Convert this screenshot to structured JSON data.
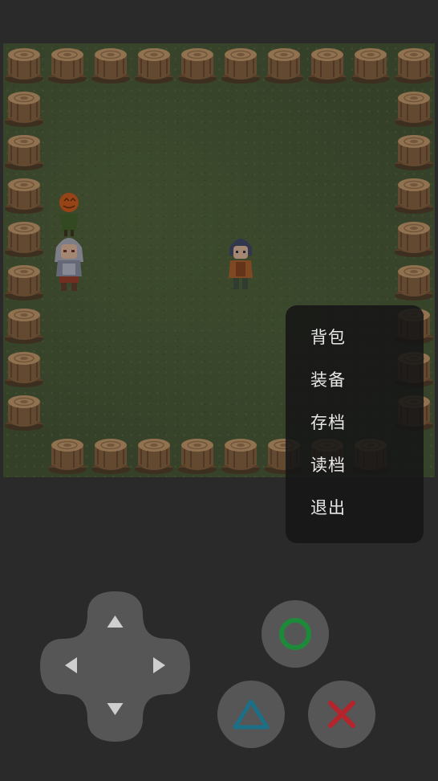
{
  "menu": {
    "items": [
      {
        "label": "背包"
      },
      {
        "label": "装备"
      },
      {
        "label": "存档"
      },
      {
        "label": "读档"
      },
      {
        "label": "退出"
      }
    ]
  },
  "controls": {
    "dpad_icons": [
      "arrow-up-icon",
      "arrow-down-icon",
      "arrow-left-icon",
      "arrow-right-icon"
    ],
    "action_buttons": [
      {
        "name": "circle-button",
        "icon": "circle-icon",
        "color": "#1d8a3a"
      },
      {
        "name": "triangle-button",
        "icon": "triangle-icon",
        "color": "#1b6f86"
      },
      {
        "name": "cross-button",
        "icon": "cross-icon",
        "color": "#b5232b"
      }
    ]
  },
  "colors": {
    "background": "#2a2a2a",
    "grass": "#414f32",
    "menu_background": "#161616",
    "menu_text": "#e8e8e8",
    "button": "#565656"
  }
}
